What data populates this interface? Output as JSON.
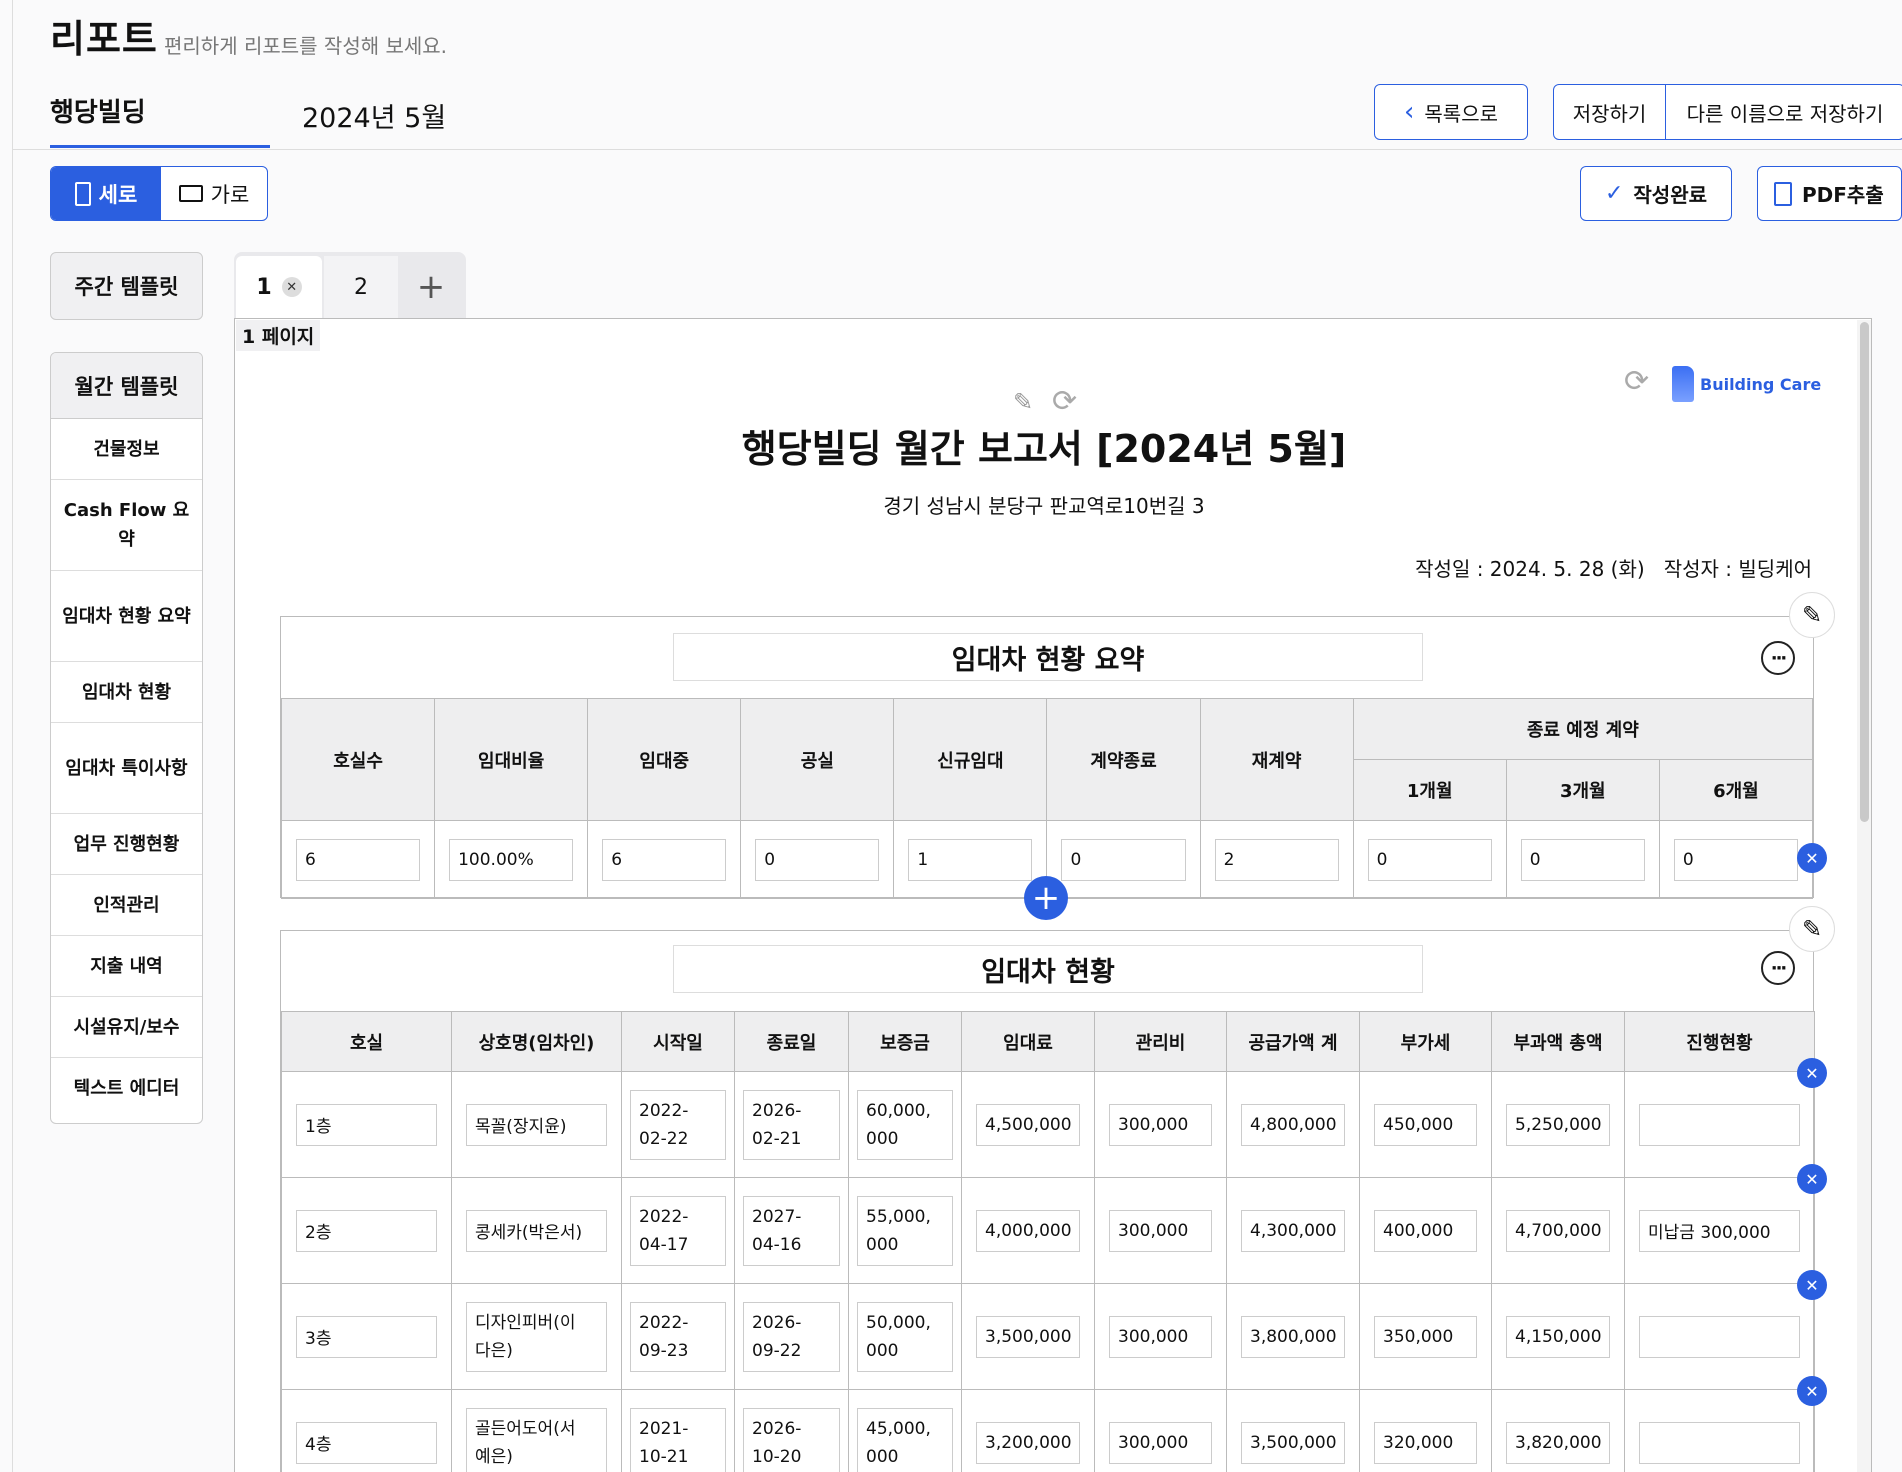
{
  "header": {
    "title": "리포트",
    "subtitle": "편리하게 리포트를 작성해 보세요.",
    "building": "행당빌딩",
    "period": "2024년 5월",
    "back_label": "목록으로",
    "save_label": "저장하기",
    "save_as_label": "다른 이름으로 저장하기"
  },
  "toolbar": {
    "portrait_label": "세로",
    "landscape_label": "가로",
    "done_label": "작성완료",
    "pdf_label": "PDF추출"
  },
  "sidebar": {
    "weekly": "주간 템플릿",
    "monthly": "월간 템플릿",
    "items": [
      "건물정보",
      "Cash Flow 요약",
      "임대차 현황 요약",
      "임대차 현황",
      "임대차 특이사항",
      "업무 진행현황",
      "인적관리",
      "지출 내역",
      "시설유지/보수",
      "텍스트 에디터"
    ]
  },
  "tabs": {
    "tab1": "1",
    "tab2": "2"
  },
  "page": {
    "label": "1 페이지",
    "title": "행당빌딩 월간 보고서 [2024년 5월]",
    "address": "경기 성남시 분당구 판교역로10번길 3",
    "meta": "작성일 : 2024. 5. 28 (화)   작성자 : 빌딩케어",
    "logo_text": "Building Care"
  },
  "summary": {
    "title": "임대차 현황 요약",
    "headers": [
      "호실수",
      "임대비율",
      "임대중",
      "공실",
      "신규임대",
      "계약종료",
      "재계약"
    ],
    "group_header": "종료 예정 계약",
    "sub_headers": [
      "1개월",
      "3개월",
      "6개월"
    ],
    "values": [
      "6",
      "100.00%",
      "6",
      "0",
      "1",
      "0",
      "2",
      "0",
      "0",
      "0"
    ]
  },
  "lease": {
    "title": "임대차 현황",
    "headers": [
      "호실",
      "상호명(임차인)",
      "시작일",
      "종료일",
      "보증금",
      "임대료",
      "관리비",
      "공급가액 계",
      "부가세",
      "부과액 총액",
      "진행현황"
    ],
    "rows": [
      [
        "1층",
        "목꼴(장지윤)",
        "2022-\n02-22",
        "2026-\n02-21",
        "60,000,\n000",
        "4,500,000",
        "300,000",
        "4,800,000",
        "450,000",
        "5,250,000",
        ""
      ],
      [
        "2층",
        "콩세카(박은서)",
        "2022-\n04-17",
        "2027-\n04-16",
        "55,000,\n000",
        "4,000,000",
        "300,000",
        "4,300,000",
        "400,000",
        "4,700,000",
        "미납금 300,000"
      ],
      [
        "3층",
        "디자인피버(이\n다은)",
        "2022-\n09-23",
        "2026-\n09-22",
        "50,000,\n000",
        "3,500,000",
        "300,000",
        "3,800,000",
        "350,000",
        "4,150,000",
        ""
      ],
      [
        "4층",
        "골든어도어(서\n예은)",
        "2021-\n10-21",
        "2026-\n10-20",
        "45,000,\n000",
        "3,200,000",
        "300,000",
        "3,500,000",
        "320,000",
        "3,820,000",
        ""
      ]
    ]
  },
  "colors": {
    "accent": "#2b5fe0"
  },
  "icons": {
    "back": "chevron-left-icon",
    "check": "check-icon",
    "pdf": "document-icon",
    "refresh": "refresh-icon",
    "edit": "pencil-icon",
    "more": "more-icon",
    "remove": "close-circle-icon",
    "add": "plus-circle-icon"
  }
}
